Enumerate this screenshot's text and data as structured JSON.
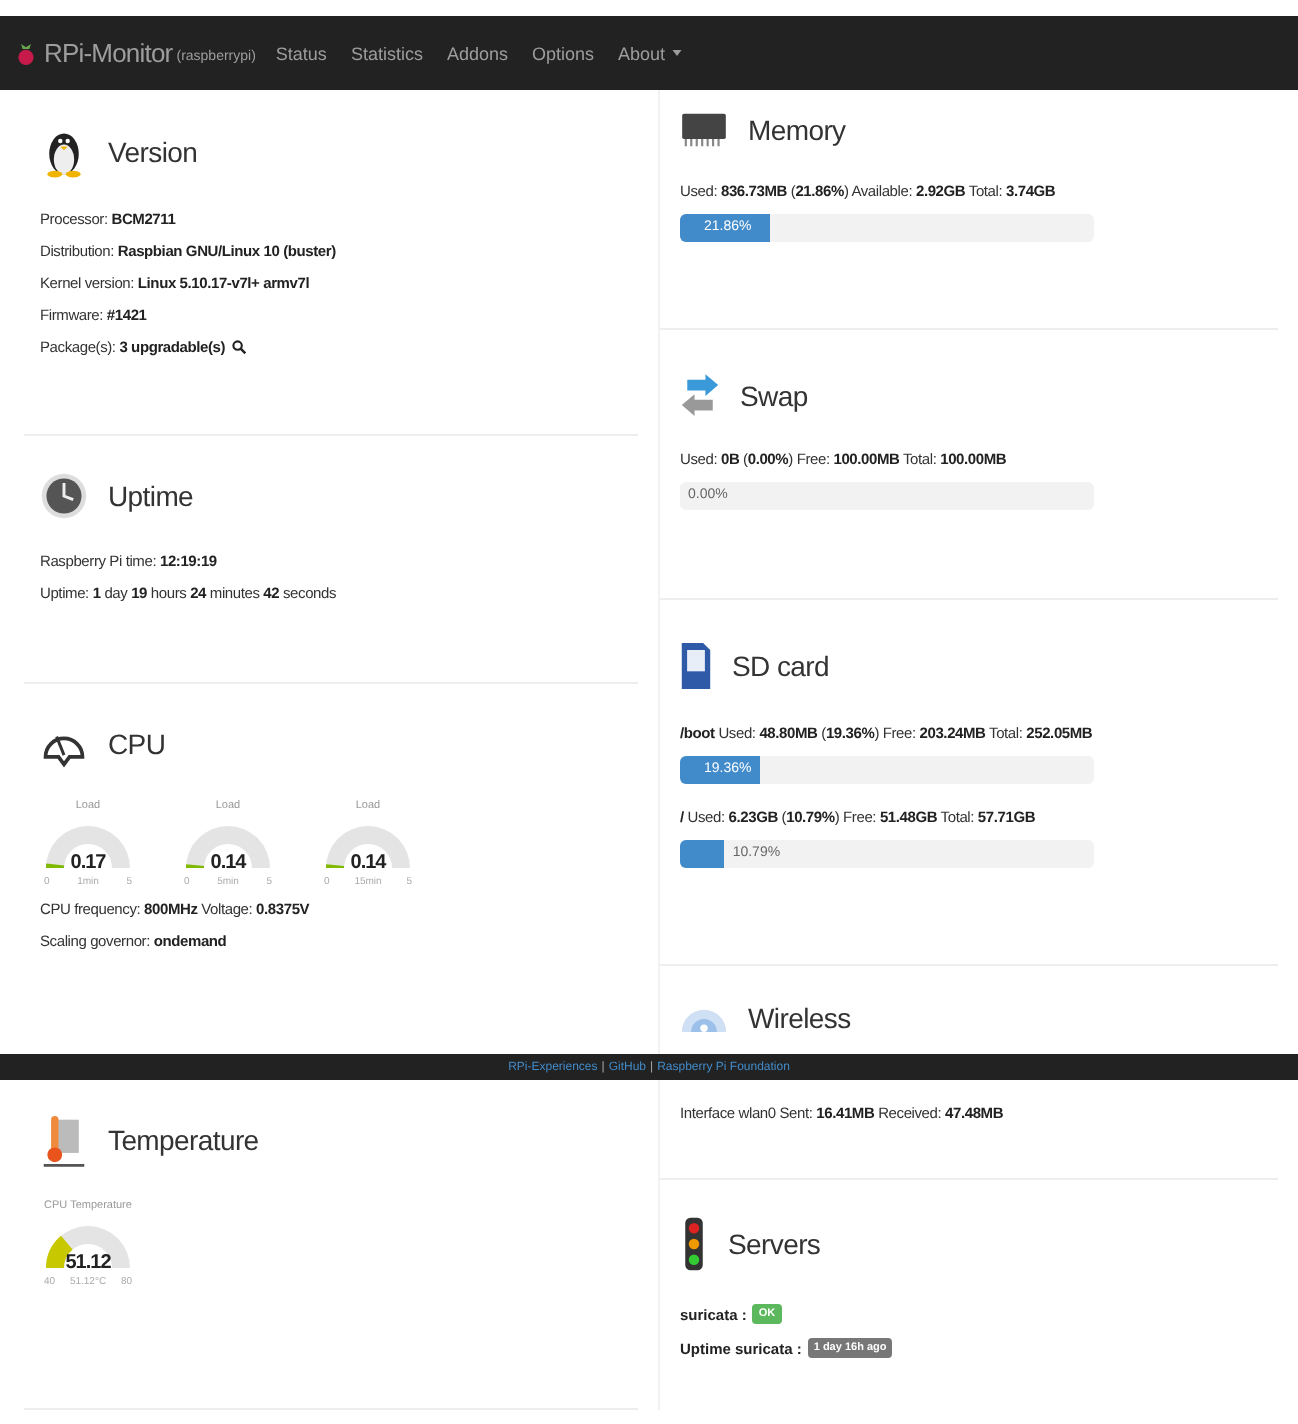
{
  "navbar": {
    "brand": "RPi-Monitor",
    "host": "(raspberrypi)",
    "items": [
      {
        "label": "Status",
        "dropdown": false
      },
      {
        "label": "Statistics",
        "dropdown": false
      },
      {
        "label": "Addons",
        "dropdown": false
      },
      {
        "label": "Options",
        "dropdown": false
      },
      {
        "label": "About",
        "dropdown": true
      }
    ]
  },
  "top": {
    "left": [
      {
        "title": "Version",
        "rows": [
          {
            "kind": "text",
            "text": "Processor: **BCM2711**"
          },
          {
            "kind": "text",
            "text": "Distribution: **Raspbian GNU/Linux 10 (buster)**"
          },
          {
            "kind": "text",
            "text": "Kernel version: **Linux 5.10.17-v7l+ armv7l**"
          },
          {
            "kind": "text",
            "text": "Firmware: **#1421**"
          },
          {
            "kind": "text",
            "text": "Package(s): **3 upgradable(s)**",
            "search": true
          }
        ]
      },
      {
        "title": "Uptime",
        "rows": [
          {
            "kind": "text",
            "text": "Raspberry Pi time: **12:19:19**"
          },
          {
            "kind": "text",
            "text": "Uptime: **1** day **19** hours **24** minutes **42** seconds"
          }
        ]
      },
      {
        "title": "CPU",
        "rows": [
          {
            "kind": "gauges",
            "gauges": [
              {
                "title": "Load",
                "value": "0.17",
                "min": "0",
                "max": "5",
                "label": "1min",
                "color": "#7fba00"
              },
              {
                "title": "Load",
                "value": "0.14",
                "min": "0",
                "max": "5",
                "label": "5min",
                "color": "#7fba00"
              },
              {
                "title": "Load",
                "value": "0.14",
                "min": "0",
                "max": "5",
                "label": "15min",
                "color": "#7fba00"
              }
            ]
          },
          {
            "kind": "text",
            "text": "CPU frequency: **800MHz** Voltage: **0.8375V**"
          },
          {
            "kind": "text",
            "text": "Scaling governor: **ondemand**"
          }
        ]
      }
    ],
    "right": [
      {
        "title": "Memory",
        "rows": [
          {
            "kind": "text",
            "text": "Used: **836.73MB** (**21.86%**) Available: **2.92GB** Total: **3.74GB**"
          },
          {
            "kind": "bar",
            "level": 0.2186,
            "label": "21.86%"
          }
        ]
      },
      {
        "title": "Swap",
        "rows": [
          {
            "kind": "text",
            "text": "Used: **0B** (**0.00%**) Free: **100.00MB** Total: **100.00MB**"
          },
          {
            "kind": "bar",
            "label": "0.00%"
          }
        ]
      },
      {
        "title": "SD card",
        "rows": [
          {
            "kind": "text",
            "text": "**/boot** Used: **48.80MB** (**19.36%**) Free: **203.24MB** Total: **252.05MB**"
          },
          {
            "kind": "bar",
            "level": 0.1936,
            "label": "19.36%"
          },
          {
            "kind": "text",
            "text": "**/** Used: **6.23GB** (**10.79%**) Free: **51.48GB** Total: **57.71GB**"
          },
          {
            "kind": "bar",
            "level": 0.1079,
            "label": "10.79%"
          }
        ]
      },
      {
        "title": "Wireless"
      }
    ]
  },
  "footer": {
    "separator": "|",
    "links": [
      "RPi-Experiences",
      "GitHub",
      "Raspberry Pi Foundation"
    ]
  },
  "bottom": {
    "left": [
      {
        "title": "Temperature",
        "rows": [
          {
            "kind": "gauges",
            "gauges": [
              {
                "title": "CPU Temperature",
                "value": "51.12",
                "min": "40",
                "max": "80",
                "label": "51.12°C",
                "color": "#c8c800"
              }
            ]
          }
        ]
      }
    ],
    "right": [
      {
        "rows": [
          {
            "kind": "text",
            "text": "Interface wlan0 Sent: **16.41MB** Received: **47.48MB**"
          }
        ]
      },
      {
        "title": "Servers",
        "rows": [
          {
            "kind": "status",
            "label": "suricata :",
            "badge": "OK",
            "color": "#5cb85c"
          },
          {
            "kind": "status",
            "label": "Uptime suricata :",
            "badge": "1 day 16h ago",
            "color": "#777777"
          }
        ]
      }
    ]
  }
}
